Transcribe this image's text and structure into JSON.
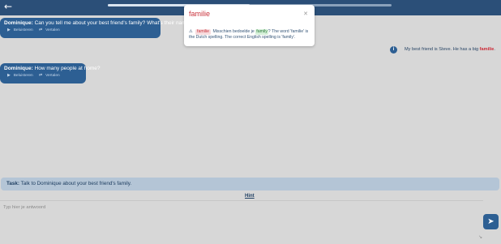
{
  "progress": {
    "fraction": 0.5
  },
  "messages": [
    {
      "speaker": "Dominique:",
      "text": "Can you tell me about your best friend's family? What's their name?",
      "actions": [
        "Beluisteren",
        "Vertalen"
      ]
    },
    {
      "speaker": "Dominique:",
      "text": "How many people at home?",
      "actions": [
        "Beluisteren",
        "Vertalen"
      ]
    }
  ],
  "user_message": {
    "prefix": "My best friend is Steve. He has a big",
    "mistake": "familie",
    "suffix": "."
  },
  "popup": {
    "title": "familie",
    "wrong_word": "familie",
    "text_before": "Misschien bedoelde je",
    "suggestion": "family",
    "text_after": "? The word 'familie' is the Dutch spelling. The correct English spelling is 'family'."
  },
  "task": {
    "label": "Task:",
    "text": "Talk to Dominique about your best friend's family."
  },
  "hint_label": "Hint",
  "answer": {
    "placeholder": "Typ hier je antwoord",
    "value": ""
  },
  "icons": {
    "back": "arrow-left-icon",
    "close": "close-icon",
    "warning": "warning-icon",
    "info": "info-icon",
    "send": "paper-plane-icon",
    "listen": "speaker-icon",
    "translate": "translate-icon"
  },
  "colors": {
    "header": "#2b4f78",
    "bubble": "#2d5f93",
    "task_bar": "#b4c5d6",
    "error": "#c9333c",
    "correct": "#2b7a3a"
  }
}
